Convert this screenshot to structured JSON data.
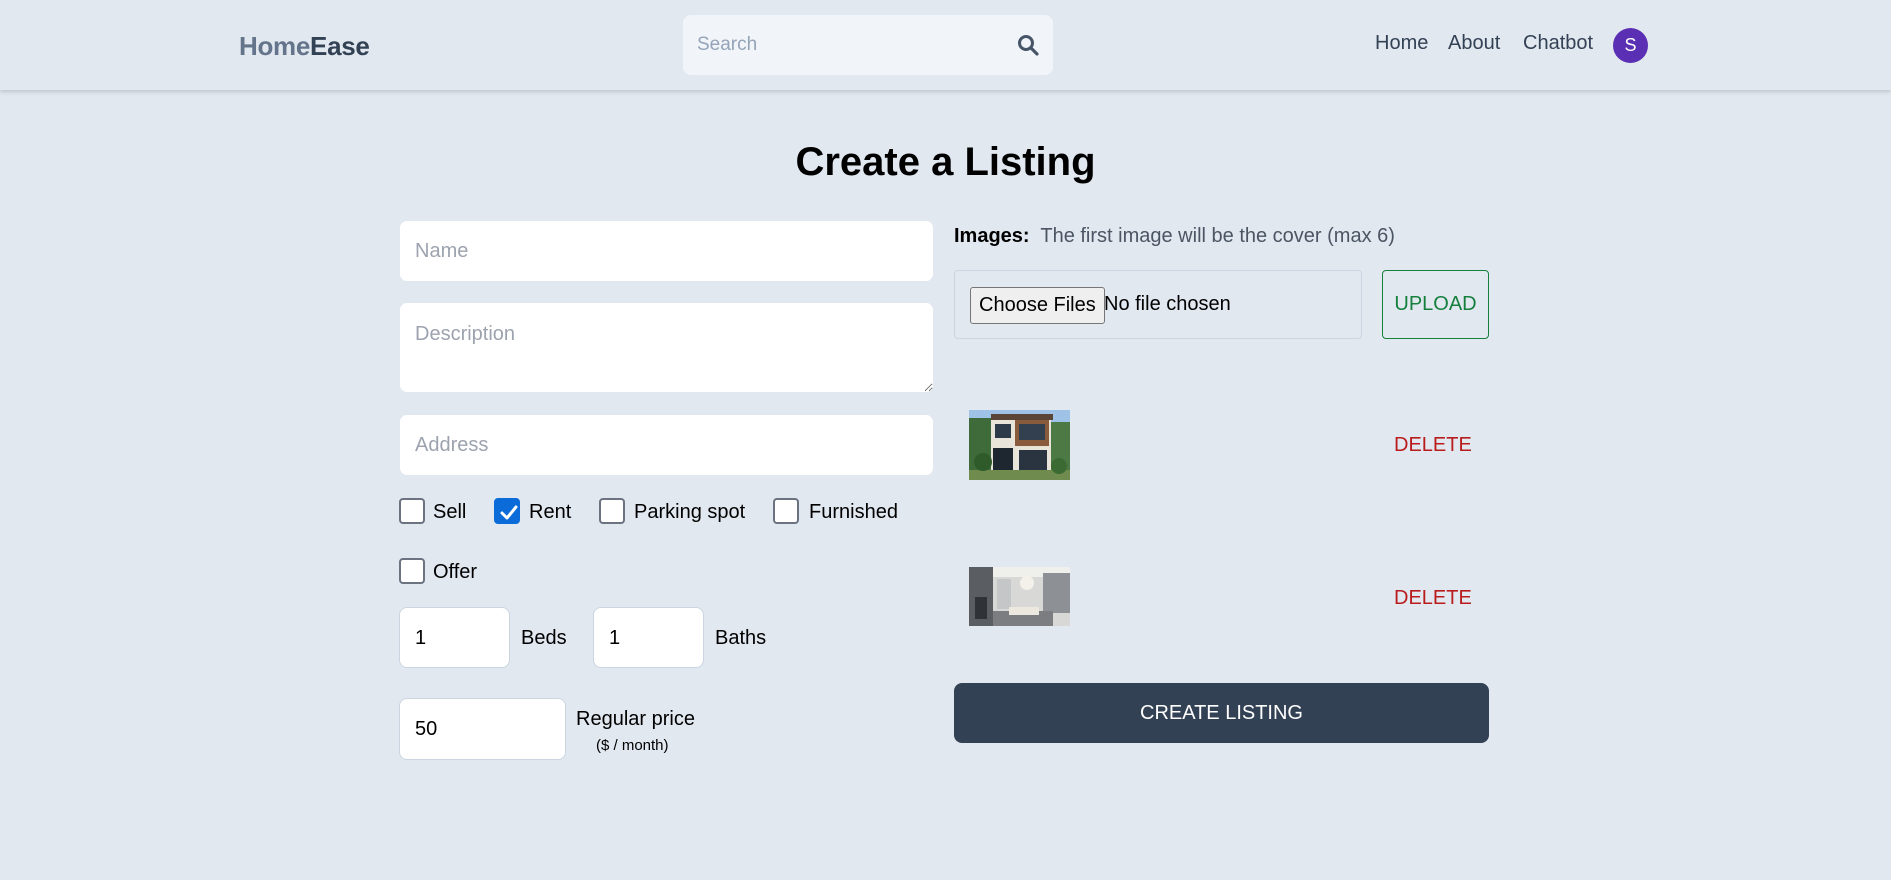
{
  "header": {
    "logo_part1": "Home",
    "logo_part2": "Ease",
    "search_placeholder": "Search",
    "nav": [
      "Home",
      "About",
      "Chatbot"
    ],
    "avatar_letter": "S"
  },
  "page": {
    "title": "Create a Listing"
  },
  "form": {
    "name_placeholder": "Name",
    "description_placeholder": "Description",
    "address_placeholder": "Address",
    "checkboxes": [
      {
        "label": "Sell",
        "checked": false
      },
      {
        "label": "Rent",
        "checked": true
      },
      {
        "label": "Parking spot",
        "checked": false
      },
      {
        "label": "Furnished",
        "checked": false
      },
      {
        "label": "Offer",
        "checked": false
      }
    ],
    "beds": {
      "value": "1",
      "label": "Beds"
    },
    "baths": {
      "value": "1",
      "label": "Baths"
    },
    "price": {
      "value": "50",
      "label": "Regular price",
      "sub": "($ / month)"
    }
  },
  "images": {
    "label": "Images:",
    "hint": "The first image will be the cover (max 6)",
    "choose_files": "Choose Files",
    "file_status": "No file chosen",
    "upload": "UPLOAD",
    "items": [
      {
        "delete": "DELETE"
      },
      {
        "delete": "DELETE"
      }
    ]
  },
  "submit": {
    "label": "CREATE LISTING"
  },
  "colors": {
    "background": "#e2e8f0",
    "primary_button": "#334155",
    "upload_green": "#15803d",
    "delete_red": "#b91c1c",
    "checkbox_blue": "#0b6bd8",
    "avatar": "#5b2fb3"
  }
}
